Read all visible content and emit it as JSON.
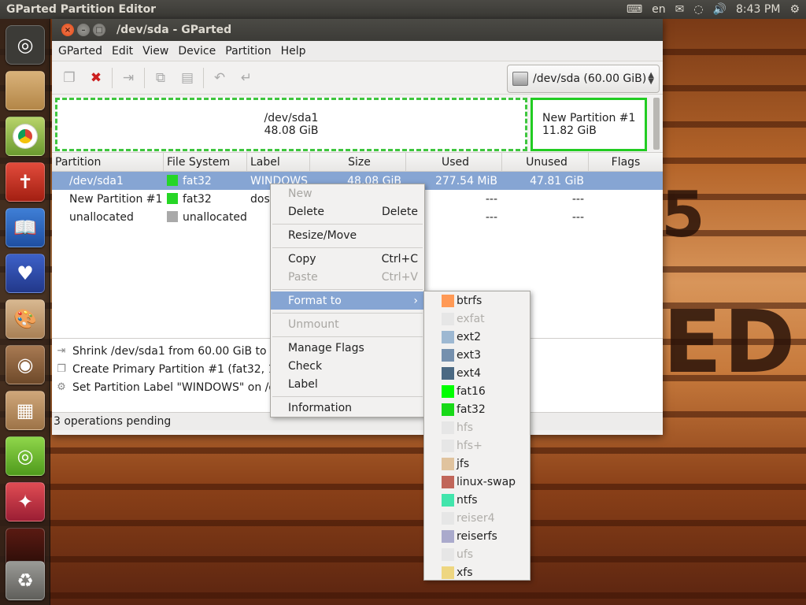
{
  "top_panel": {
    "app_title": "GParted Partition Editor",
    "keyboard_layout": "en",
    "clock": "8:43 PM"
  },
  "window": {
    "title": "/dev/sda - GParted"
  },
  "menubar": {
    "items": [
      "GParted",
      "Edit",
      "View",
      "Device",
      "Partition",
      "Help"
    ]
  },
  "toolbar": {
    "device": "/dev/sda  (60.00 GiB)"
  },
  "graph": {
    "part1_name": "/dev/sda1",
    "part1_size": "48.08 GiB",
    "part2_name": "New Partition #1",
    "part2_size": "11.82 GiB"
  },
  "table": {
    "headers": [
      "Partition",
      "File System",
      "Label",
      "Size",
      "Used",
      "Unused",
      "Flags"
    ],
    "rows": [
      {
        "partition": "/dev/sda1",
        "fs": "fat32",
        "fs_color": "#26d626",
        "label": "WINDOWS",
        "size": "48.08 GiB",
        "used": "277.54 MiB",
        "unused": "47.81 GiB"
      },
      {
        "partition": "New Partition #1",
        "fs": "fat32",
        "fs_color": "#26d626",
        "label": "dos",
        "size": "",
        "used": "---",
        "unused": "---"
      },
      {
        "partition": "unallocated",
        "fs": "unallocated",
        "fs_color": "#a9a9a9",
        "label": "",
        "size": "",
        "used": "---",
        "unused": "---"
      }
    ]
  },
  "operations": [
    "Shrink /dev/sda1 from 60.00 GiB to 48",
    "Create Primary Partition #1 (fat32, 11",
    "Set Partition Label \"WINDOWS\" on /de"
  ],
  "statusbar": "3 operations pending",
  "context_menu": {
    "new": "New",
    "delete": "Delete",
    "delete_accel": "Delete",
    "resize": "Resize/Move",
    "copy": "Copy",
    "copy_accel": "Ctrl+C",
    "paste": "Paste",
    "paste_accel": "Ctrl+V",
    "format_to": "Format to",
    "unmount": "Unmount",
    "manage_flags": "Manage Flags",
    "check": "Check",
    "label": "Label",
    "information": "Information"
  },
  "format_submenu": [
    {
      "name": "btrfs",
      "color": "#ff9955",
      "enabled": true
    },
    {
      "name": "exfat",
      "color": "#d8d8d8",
      "enabled": false
    },
    {
      "name": "ext2",
      "color": "#9db8d2",
      "enabled": true
    },
    {
      "name": "ext3",
      "color": "#7590ae",
      "enabled": true
    },
    {
      "name": "ext4",
      "color": "#4b6983",
      "enabled": true
    },
    {
      "name": "fat16",
      "color": "#00ff00",
      "enabled": true
    },
    {
      "name": "fat32",
      "color": "#18d918",
      "enabled": true
    },
    {
      "name": "hfs",
      "color": "#e6e6e6",
      "enabled": false
    },
    {
      "name": "hfs+",
      "color": "#e6e6e6",
      "enabled": false
    },
    {
      "name": "jfs",
      "color": "#e0c39e",
      "enabled": true
    },
    {
      "name": "linux-swap",
      "color": "#c1665a",
      "enabled": true
    },
    {
      "name": "ntfs",
      "color": "#42e5ac",
      "enabled": true
    },
    {
      "name": "reiser4",
      "color": "#e6e6e6",
      "enabled": false
    },
    {
      "name": "reiserfs",
      "color": "#aaaacc",
      "enabled": true
    },
    {
      "name": "ufs",
      "color": "#e6e6e6",
      "enabled": false
    },
    {
      "name": "xfs",
      "color": "#eed680",
      "enabled": true
    }
  ]
}
